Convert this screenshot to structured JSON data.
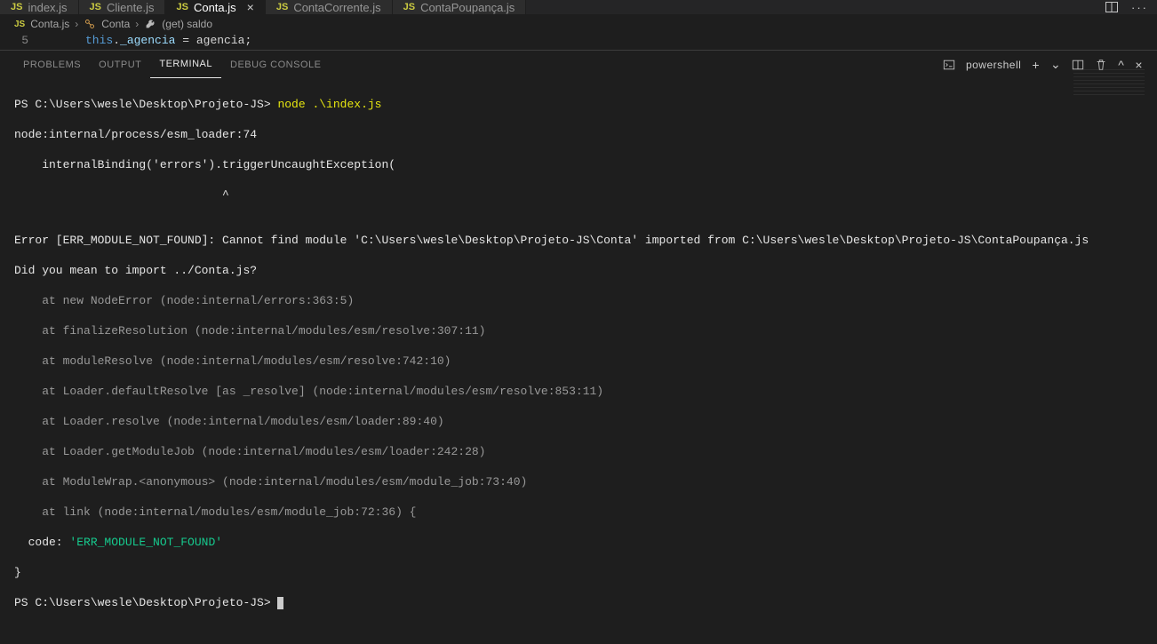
{
  "tabs": [
    {
      "icon": "JS",
      "label": "index.js",
      "active": false
    },
    {
      "icon": "JS",
      "label": "Cliente.js",
      "active": false
    },
    {
      "icon": "JS",
      "label": "Conta.js",
      "active": true
    },
    {
      "icon": "JS",
      "label": "ContaCorrente.js",
      "active": false
    },
    {
      "icon": "JS",
      "label": "ContaPoupança.js",
      "active": false
    }
  ],
  "close_glyph": "×",
  "breadcrumb": {
    "file_icon": "JS",
    "file": "Conta.js",
    "sep": "›",
    "class": "Conta",
    "method": "(get) saldo"
  },
  "editor": {
    "line_no": "5",
    "kw": "this",
    "dot": ".",
    "prop": "_agencia",
    "rest": " = agencia;"
  },
  "panel_tabs": {
    "problems": "Problems",
    "output": "Output",
    "terminal": "Terminal",
    "debug": "Debug Console"
  },
  "panel_right": {
    "shell": "powershell",
    "plus": "+",
    "chev_down": "⌄",
    "split": "❘❘",
    "trash": "🗑",
    "caret_up": "^",
    "close": "×"
  },
  "terminal": {
    "prompt1_path": "PS C:\\Users\\wesle\\Desktop\\Projeto-JS> ",
    "cmd": "node .\\index.js",
    "l2": "node:internal/process/esm_loader:74",
    "l3": "    internalBinding('errors').triggerUncaughtException(",
    "l4": "                              ^",
    "blank": "",
    "err_line": "Error [ERR_MODULE_NOT_FOUND]: Cannot find module 'C:\\Users\\wesle\\Desktop\\Projeto-JS\\Conta' imported from C:\\Users\\wesle\\Desktop\\Projeto-JS\\ContaPoupança.js",
    "suggest": "Did you mean to import ../Conta.js?",
    "stack": [
      "    at new NodeError (node:internal/errors:363:5)",
      "    at finalizeResolution (node:internal/modules/esm/resolve:307:11)",
      "    at moduleResolve (node:internal/modules/esm/resolve:742:10)",
      "    at Loader.defaultResolve [as _resolve] (node:internal/modules/esm/resolve:853:11)",
      "    at Loader.resolve (node:internal/modules/esm/loader:89:40)",
      "    at Loader.getModuleJob (node:internal/modules/esm/loader:242:28)",
      "    at ModuleWrap.<anonymous> (node:internal/modules/esm/module_job:73:40)"
    ],
    "stack_last": "    at link (node:internal/modules/esm/module_job:72:36) {",
    "code_label": "  code: ",
    "code_val": "'ERR_MODULE_NOT_FOUND'",
    "brace": "}",
    "prompt2_path": "PS C:\\Users\\wesle\\Desktop\\Projeto-JS> "
  }
}
